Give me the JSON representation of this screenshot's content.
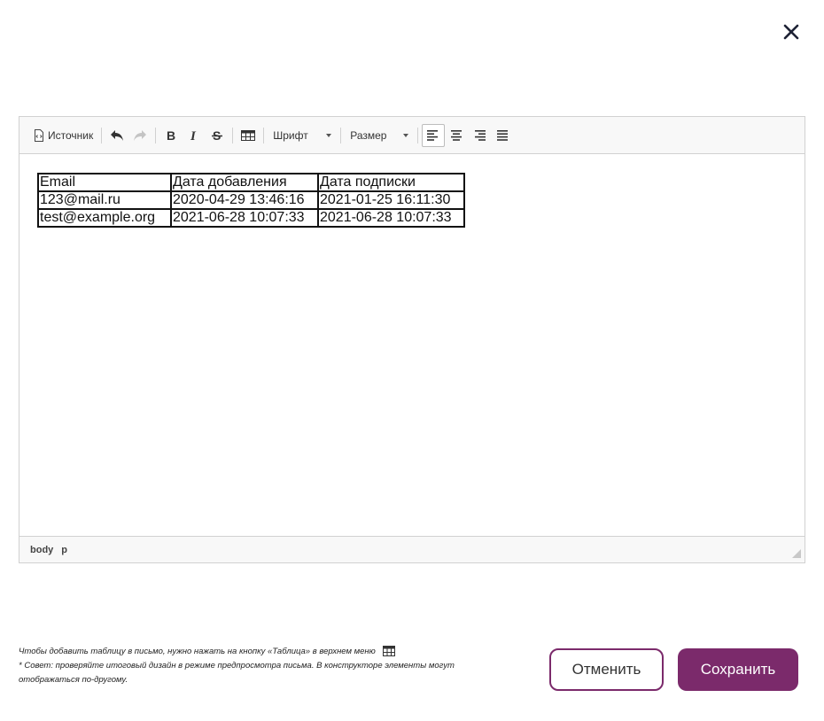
{
  "dialog": {
    "close_icon": "close-icon"
  },
  "toolbar": {
    "source_label": "Источник",
    "font_label": "Шрифт",
    "size_label": "Размер",
    "icons": {
      "source": "source-code-icon",
      "undo": "undo-icon",
      "redo": "redo-icon",
      "bold": "bold-icon",
      "italic": "italic-icon",
      "strike": "strikethrough-icon",
      "table": "table-icon",
      "align_left": "align-left-icon",
      "align_center": "align-center-icon",
      "align_right": "align-right-icon",
      "justify": "align-justify-icon"
    }
  },
  "table": {
    "rows": [
      [
        "Email",
        "Дата добавления",
        "Дата подписки"
      ],
      [
        "123@mail.ru",
        "2020-04-29 13:46:16",
        "2021-01-25 16:11:30"
      ],
      [
        "test@example.org",
        "2021-06-28 10:07:33",
        "2021-06-28 10:07:33"
      ]
    ]
  },
  "statusbar": {
    "path": [
      "body",
      "p"
    ]
  },
  "footer": {
    "hint_line1": "Чтобы добавить таблицу в письмо, нужно нажать на кнопку «Таблица» в верхнем меню",
    "hint_line2": "* Совет: проверяйте итоговый дизайн в режиме предпросмотра письма. В конструкторе элементы могут отображаться по-другому.",
    "cancel_label": "Отменить",
    "save_label": "Сохранить"
  },
  "colors": {
    "accent": "#7b2a6b",
    "toolbar_bg": "#f8f8f8",
    "border": "#d1d1d1"
  }
}
